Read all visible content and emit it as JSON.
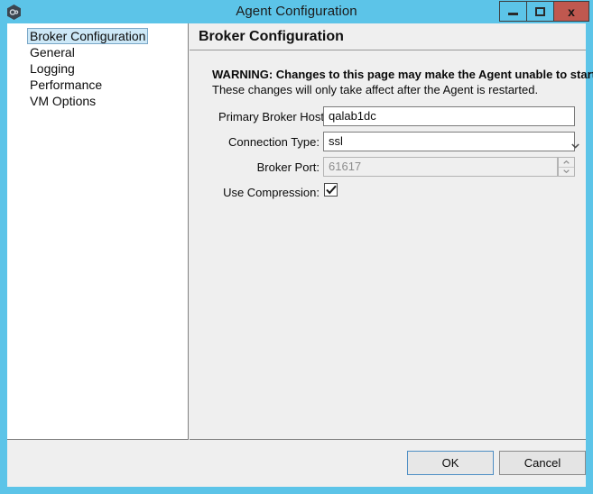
{
  "window": {
    "title": "Agent Configuration",
    "icon": "agent-hexagon-icon",
    "accent_color": "#5cc4e8",
    "close_color": "#c0584f",
    "controls": {
      "minimize_label": "",
      "maximize_label": "",
      "close_label": "x"
    }
  },
  "sidebar": {
    "items": [
      {
        "label": "Broker Configuration",
        "selected": true
      },
      {
        "label": "General",
        "selected": false
      },
      {
        "label": "Logging",
        "selected": false
      },
      {
        "label": "Performance",
        "selected": false
      },
      {
        "label": "VM Options",
        "selected": false
      }
    ],
    "selection_fill": "#cde8f7",
    "selection_border": "#7aa7c7"
  },
  "pane": {
    "title": "Broker Configuration",
    "warning": {
      "line1": "WARNING: Changes to this page may make the Agent unable to start.",
      "line2": "These changes will only take affect after the Agent is restarted."
    },
    "fields": {
      "primary_broker_host": {
        "label": "Primary Broker Host:",
        "value": "qalab1dc",
        "placeholder": ""
      },
      "connection_type": {
        "label": "Connection Type:",
        "value": "ssl",
        "options": [
          "ssl"
        ]
      },
      "broker_port": {
        "label": "Broker Port:",
        "value": "61617",
        "disabled": true
      },
      "use_compression": {
        "label": "Use Compression:",
        "checked": true,
        "check_glyph": "✔"
      }
    }
  },
  "footer": {
    "ok_label": "OK",
    "cancel_label": "Cancel"
  }
}
